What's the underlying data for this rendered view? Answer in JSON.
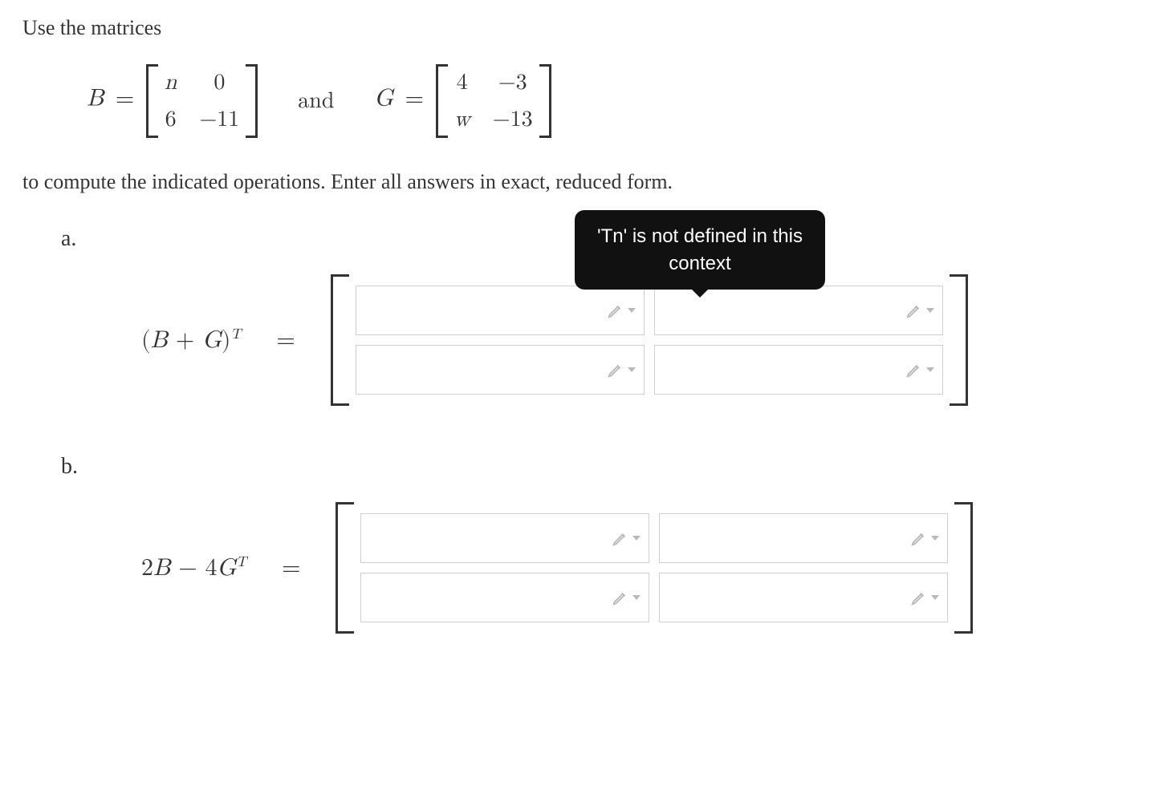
{
  "intro": "Use the matrices",
  "definition": {
    "B_label": "B",
    "G_label": "G",
    "and": "and",
    "equals": "=",
    "B": {
      "r1c1": "n",
      "r1c2": "0",
      "r2c1": "6",
      "r2c2": "−11"
    },
    "G": {
      "r1c1": "4",
      "r1c2": "−3",
      "r2c1": "w",
      "r2c2": "−13"
    }
  },
  "instruction": "to compute the indicated operations. Enter all answers in exact, reduced form.",
  "parts": {
    "a": {
      "label": "a.",
      "expr_open": "(",
      "expr_B": "B",
      "expr_plus": " + ",
      "expr_G": "G",
      "expr_close": ")",
      "expr_sup": "T",
      "equals": "="
    },
    "b": {
      "label": "b.",
      "expr_2": "2",
      "expr_B": "B",
      "expr_minus": " − ",
      "expr_4": "4",
      "expr_G": "G",
      "expr_sup": "T",
      "equals": "="
    }
  },
  "tooltip": {
    "line1": "'Tn' is not defined in this",
    "line2": "context"
  }
}
